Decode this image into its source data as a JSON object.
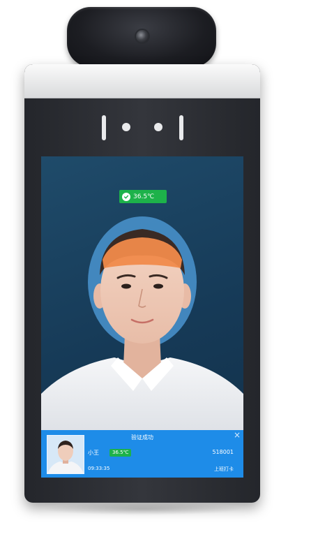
{
  "device": {
    "body_color": "#2b2d32",
    "top_color": "#f2f2f2"
  },
  "screen": {
    "temperature_badge": {
      "value": "36.5℃",
      "status_color": "#1db24a"
    },
    "info_panel": {
      "title": "验证成功",
      "name": "小王",
      "temperature": "36.5℃",
      "employee_id": "518001",
      "time": "09:33:35",
      "status": "上班打卡",
      "close_symbol": "×",
      "panel_color": "#1e8ce8"
    }
  },
  "icons": {
    "check": "check-icon",
    "close": "close-icon",
    "camera": "camera-lens-icon"
  }
}
